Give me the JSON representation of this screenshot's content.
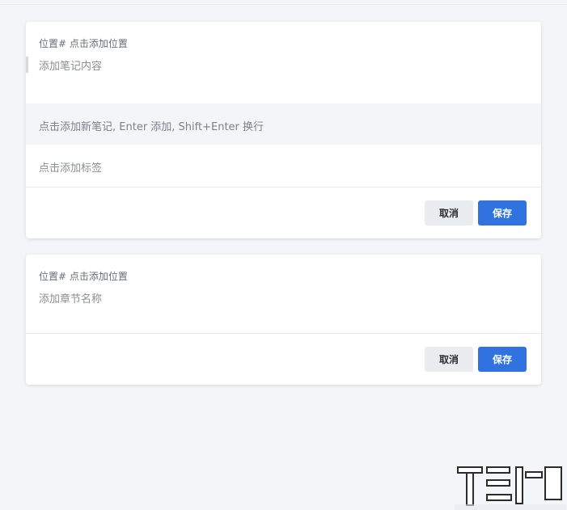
{
  "note_card": {
    "location_label": "位置# 点击添加位置",
    "content_placeholder": "添加笔记内容",
    "add_hint": "点击添加新笔记, Enter 添加, Shift+Enter 换行",
    "tag_placeholder": "点击添加标签",
    "cancel_label": "取消",
    "save_label": "保存"
  },
  "chapter_card": {
    "location_label": "位置# 点击添加位置",
    "chapter_placeholder": "添加章节名称",
    "cancel_label": "取消",
    "save_label": "保存"
  },
  "colors": {
    "background": "#f4f5f9",
    "primary": "#2f72e0",
    "cancel_bg": "#ebecef"
  }
}
